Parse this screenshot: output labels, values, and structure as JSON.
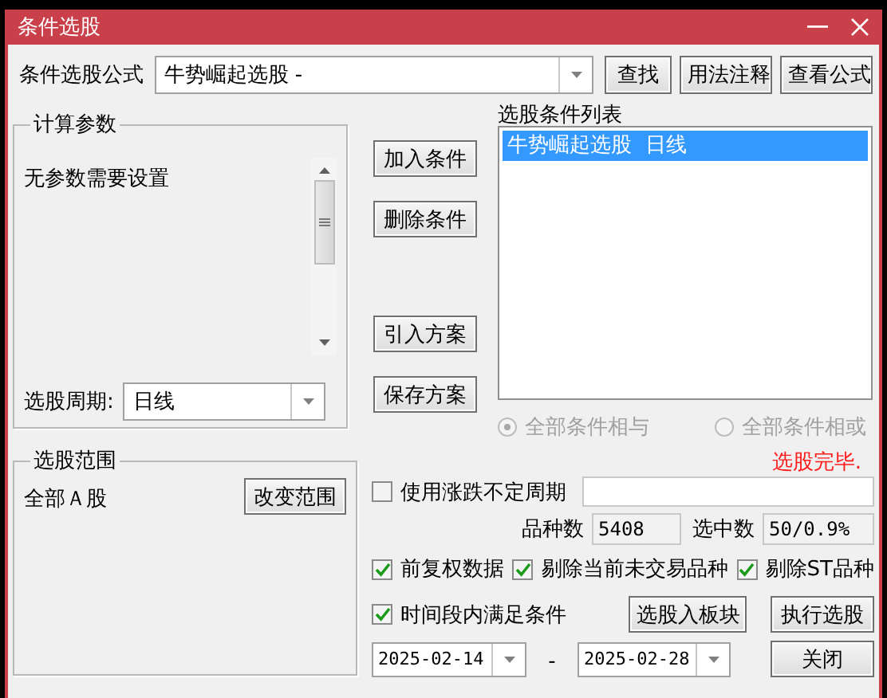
{
  "window": {
    "title": "条件选股"
  },
  "formula": {
    "label": "条件选股公式",
    "value": "牛势崛起选股  -",
    "buttons": [
      "查找",
      "用法注释",
      "查看公式"
    ]
  },
  "params": {
    "title": "计算参数",
    "message": "无参数需要设置",
    "period_label": "选股周期:",
    "period_value": "日线"
  },
  "actions": [
    "加入条件",
    "删除条件",
    "引入方案",
    "保存方案"
  ],
  "condition_list": {
    "title": "选股条件列表",
    "items": [
      {
        "label": "牛势崛起选股  日线",
        "selected": true
      }
    ]
  },
  "logic": [
    {
      "label": "全部条件相与",
      "selected": true,
      "disabled": true
    },
    {
      "label": "全部条件相或",
      "selected": false,
      "disabled": true
    }
  ],
  "scope": {
    "title": "选股范围",
    "value": "全部Ａ股",
    "button": "改变范围"
  },
  "status": "选股完毕.",
  "variable_period": {
    "label": "使用涨跌不定周期",
    "checked": false
  },
  "counts": [
    {
      "label": "品种数",
      "value": "5408"
    },
    {
      "label": "选中数",
      "value": "50/0.9%"
    }
  ],
  "options": [
    {
      "label": "前复权数据",
      "checked": true
    },
    {
      "label": "剔除当前未交易品种",
      "checked": true
    },
    {
      "label": "剔除ST品种",
      "checked": true
    }
  ],
  "time_range": {
    "label": "时间段内满足条件",
    "checked": true,
    "start": "2025-02-14",
    "separator": "-",
    "end": "2025-02-28"
  },
  "buttons": [
    "选股入板块",
    "执行选股",
    "关闭"
  ]
}
